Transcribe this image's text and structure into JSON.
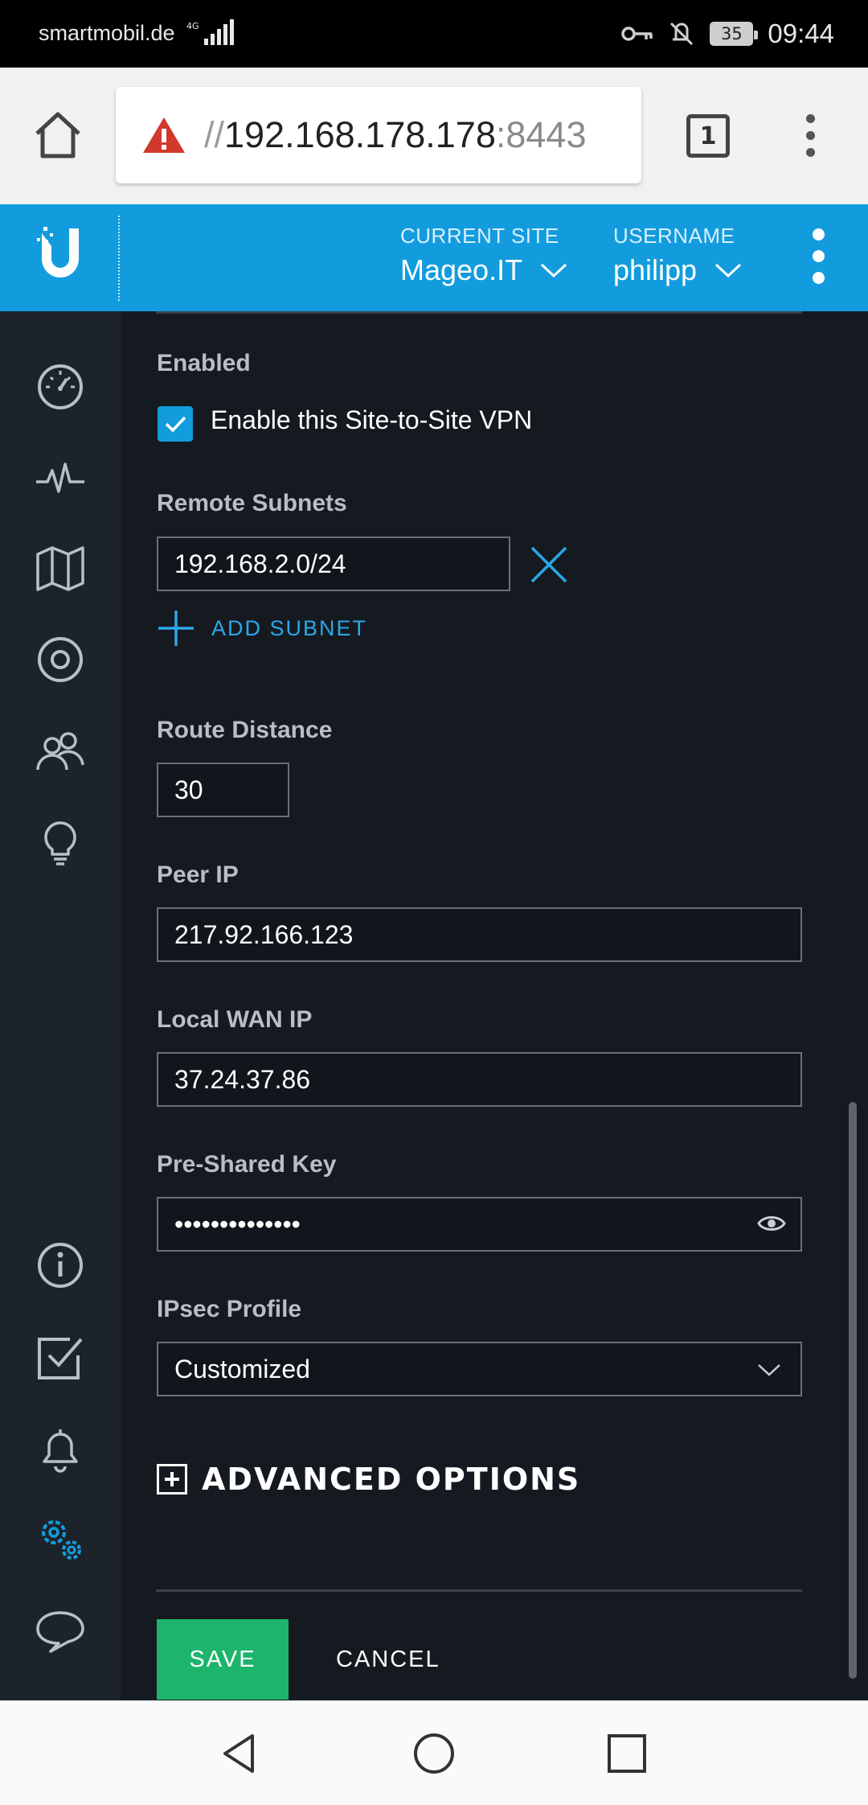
{
  "status_bar": {
    "carrier": "smartmobil.de",
    "network": "4G",
    "battery": "35",
    "time": "09:44"
  },
  "browser": {
    "url_scheme": "//",
    "url_host": "192.168.178.178",
    "url_port": ":8443",
    "tab_count": "1"
  },
  "header": {
    "current_site_label": "CURRENT SITE",
    "current_site_value": "Mageo.IT",
    "username_label": "USERNAME",
    "username_value": "philipp",
    "accent_color": "#139cdd"
  },
  "sidebar": {
    "items": [
      {
        "name": "dashboard",
        "icon": "dashboard-gauge-icon"
      },
      {
        "name": "statistics",
        "icon": "pulse-icon"
      },
      {
        "name": "map",
        "icon": "map-icon"
      },
      {
        "name": "devices",
        "icon": "target-icon"
      },
      {
        "name": "clients",
        "icon": "users-icon"
      },
      {
        "name": "insights",
        "icon": "lightbulb-icon"
      },
      {
        "name": "info",
        "icon": "info-icon"
      },
      {
        "name": "events",
        "icon": "checkbox-icon"
      },
      {
        "name": "alerts",
        "icon": "bell-icon"
      },
      {
        "name": "settings",
        "icon": "gears-icon"
      },
      {
        "name": "chat",
        "icon": "chat-bubble-icon"
      }
    ]
  },
  "form": {
    "enabled_label": "Enabled",
    "enable_checkbox_label": "Enable this Site-to-Site VPN",
    "enable_checked": true,
    "remote_subnets_label": "Remote Subnets",
    "remote_subnet_value": "192.168.2.0/24",
    "add_subnet_label": "ADD SUBNET",
    "route_distance_label": "Route Distance",
    "route_distance_value": "30",
    "peer_ip_label": "Peer IP",
    "peer_ip_value": "217.92.166.123",
    "local_wan_ip_label": "Local WAN IP",
    "local_wan_ip_value": "37.24.37.86",
    "psk_label": "Pre-Shared Key",
    "psk_value": "••••••••••••••",
    "ipsec_profile_label": "IPsec Profile",
    "ipsec_profile_value": "Customized",
    "advanced_label": "ADVANCED OPTIONS",
    "save_label": "SAVE",
    "cancel_label": "CANCEL",
    "save_color": "#1cb56b"
  }
}
